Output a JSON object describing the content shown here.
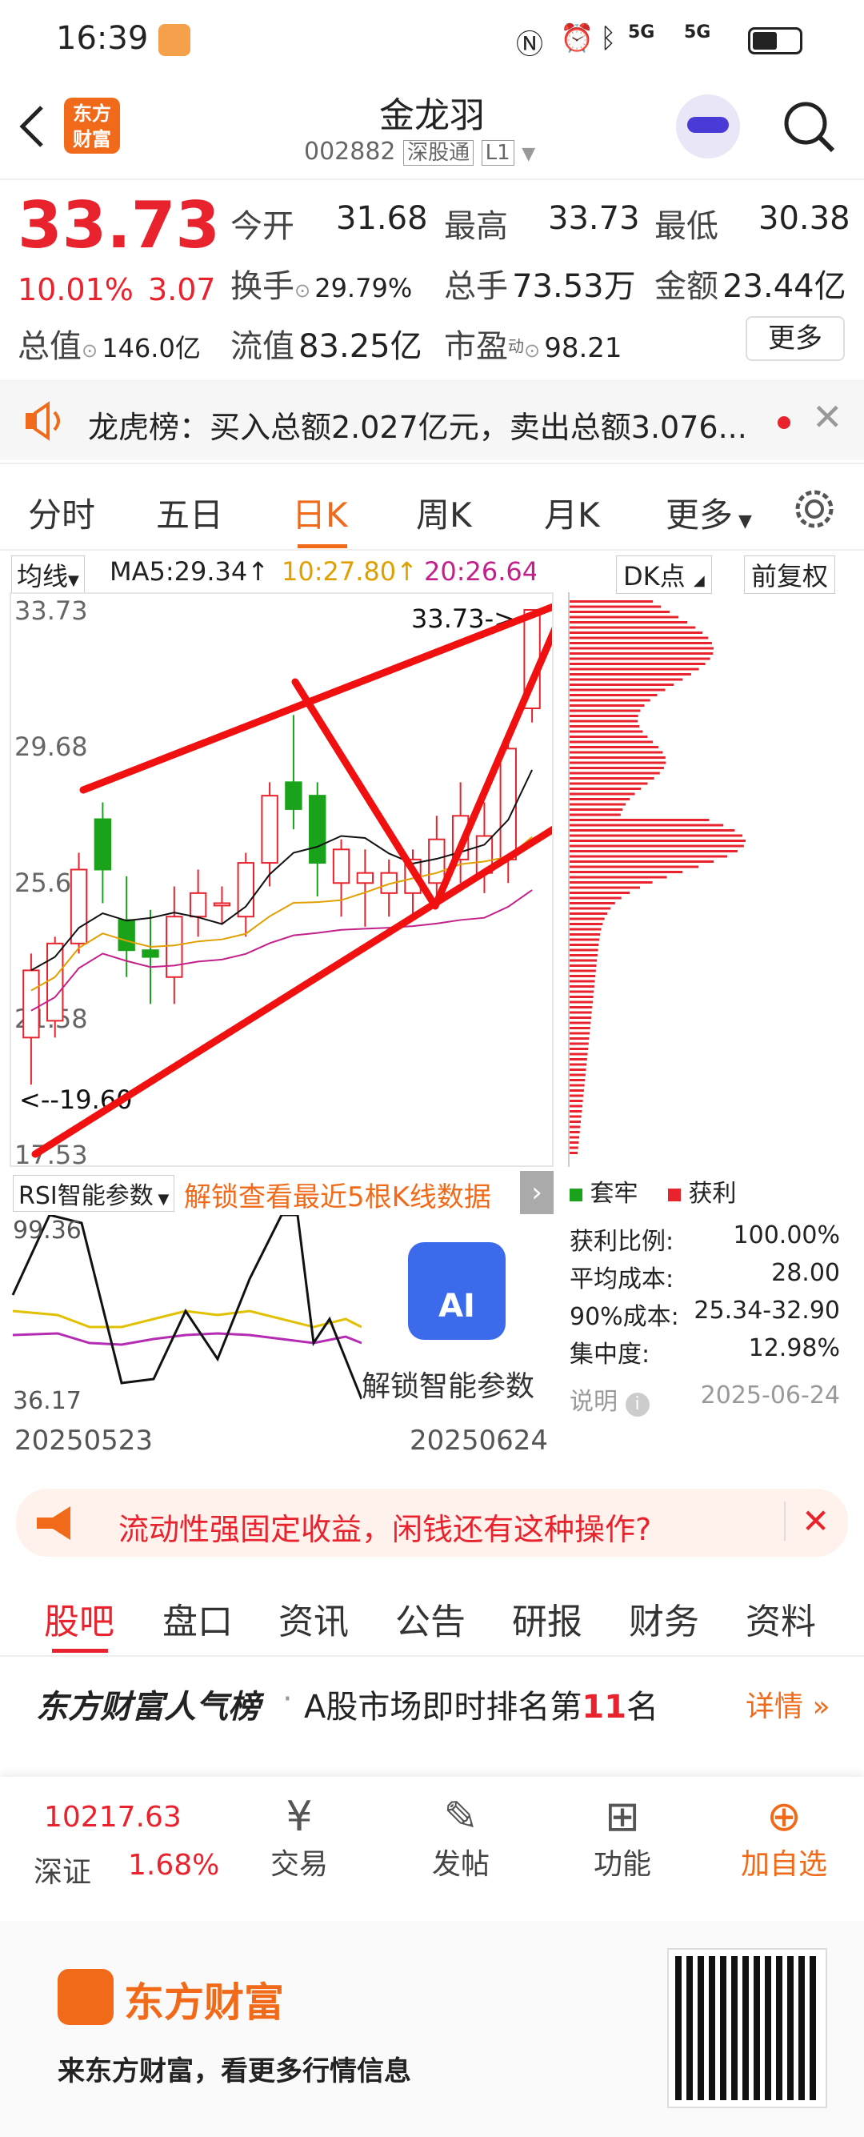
{
  "status": {
    "time": "16:39",
    "net1": "5G",
    "net2": "5G"
  },
  "header": {
    "logo_line1": "东方",
    "logo_line2": "财富",
    "title": "金龙羽",
    "code": "002882",
    "market": "深股通",
    "level": "L1"
  },
  "quote": {
    "price": "33.73",
    "change_pct": "10.01%",
    "change": "3.07",
    "open_label": "今开",
    "open": "31.68",
    "high_label": "最高",
    "high": "33.73",
    "low_label": "最低",
    "low": "30.38",
    "turnover_label": "换手",
    "turnover": "29.79%",
    "volume_label": "总手",
    "volume": "73.53万",
    "amount_label": "金额",
    "amount": "23.44亿",
    "mcap_label": "总值",
    "mcap": "146.0亿",
    "float_label": "流值",
    "float": "83.25亿",
    "pe_label": "市盈",
    "pe_sup": "动",
    "pe": "98.21",
    "more": "更多"
  },
  "notice": {
    "text": "龙虎榜：买入总额2.027亿元，卖出总额3.076..."
  },
  "tabs": [
    "分时",
    "五日",
    "日K",
    "周K",
    "月K",
    "更多"
  ],
  "indicator": {
    "ma_selector": "均线",
    "ma5": "MA5:29.34↑",
    "ma10": "10:27.80↑",
    "ma20": "20:26.64↑",
    "dk": "DK点",
    "adjust": "前复权"
  },
  "chart_data": {
    "type": "candlestick",
    "ylim": [
      17.53,
      33.73
    ],
    "y_ticks": [
      "33.73",
      "29.68",
      "25.63",
      "21.58",
      "17.53"
    ],
    "annotations": [
      "33.73->",
      "<--19.60"
    ],
    "candles": [
      {
        "o": 21.0,
        "h": 23.5,
        "l": 19.6,
        "c": 23.0
      },
      {
        "o": 21.5,
        "h": 24.0,
        "l": 21.0,
        "c": 23.8
      },
      {
        "o": 23.8,
        "h": 26.5,
        "l": 23.5,
        "c": 26.0
      },
      {
        "o": 27.5,
        "h": 28.0,
        "l": 25.0,
        "c": 26.0
      },
      {
        "o": 24.5,
        "h": 25.8,
        "l": 22.8,
        "c": 23.6
      },
      {
        "o": 23.6,
        "h": 24.8,
        "l": 22.0,
        "c": 23.4
      },
      {
        "o": 22.8,
        "h": 25.5,
        "l": 22.0,
        "c": 24.6
      },
      {
        "o": 24.6,
        "h": 26.0,
        "l": 24.0,
        "c": 25.3
      },
      {
        "o": 25.0,
        "h": 25.5,
        "l": 24.4,
        "c": 25.0
      },
      {
        "o": 24.6,
        "h": 26.5,
        "l": 24.0,
        "c": 26.2
      },
      {
        "o": 26.2,
        "h": 28.6,
        "l": 25.5,
        "c": 28.2
      },
      {
        "o": 28.6,
        "h": 30.6,
        "l": 27.2,
        "c": 27.8
      },
      {
        "o": 28.2,
        "h": 28.6,
        "l": 25.2,
        "c": 26.2
      },
      {
        "o": 25.6,
        "h": 26.9,
        "l": 24.6,
        "c": 26.6
      },
      {
        "o": 25.6,
        "h": 26.6,
        "l": 24.3,
        "c": 25.9
      },
      {
        "o": 25.3,
        "h": 26.3,
        "l": 24.6,
        "c": 25.9
      },
      {
        "o": 25.3,
        "h": 26.6,
        "l": 24.6,
        "c": 26.3
      },
      {
        "o": 25.6,
        "h": 27.6,
        "l": 25.0,
        "c": 26.9
      },
      {
        "o": 26.3,
        "h": 28.6,
        "l": 25.6,
        "c": 27.6
      },
      {
        "o": 25.9,
        "h": 28.0,
        "l": 25.3,
        "c": 27.0
      },
      {
        "o": 26.3,
        "h": 30.0,
        "l": 25.6,
        "c": 29.6
      },
      {
        "o": 30.8,
        "h": 33.73,
        "l": 30.38,
        "c": 33.73
      }
    ],
    "profile_legend": [
      "套牢",
      "获利"
    ]
  },
  "sub": {
    "rsi_selector": "RSI智能参数",
    "unlock": "解锁查看最近5根K线数据"
  },
  "rsi": {
    "top": "99.36",
    "bottom": "36.17",
    "date_start": "20250523",
    "date_end": "20250624",
    "ai_badge": "AI",
    "ai_label": "解锁智能参数"
  },
  "stats": {
    "rows": [
      {
        "k": "获利比例:",
        "v": "100.00%"
      },
      {
        "k": "平均成本:",
        "v": "28.00"
      },
      {
        "k": "90%成本:",
        "v": "25.34-32.90"
      },
      {
        "k": "集中度:",
        "v": "12.98%"
      }
    ],
    "note": "说明",
    "date": "2025-06-24"
  },
  "ad": {
    "text": "流动性强固定收益，闲钱还有这种操作?"
  },
  "ntabs": [
    "股吧",
    "盘口",
    "资讯",
    "公告",
    "研报",
    "财务",
    "资料"
  ],
  "rank": {
    "title": "东方财富人气榜",
    "desc": "A股市场即时排名第",
    "num": "11",
    "suffix": "名",
    "link": "详情"
  },
  "bnav": {
    "index_value": "10217.63",
    "index_name": "深证",
    "index_pct": "1.68%",
    "items": [
      "交易",
      "发帖",
      "功能",
      "加自选"
    ]
  },
  "footer": {
    "brand": "东方财富",
    "slogan": "来东方财富，看更多行情信息"
  },
  "colors": {
    "up": "#e8232e",
    "down": "#1aa31a",
    "orange": "#f06a1a"
  }
}
